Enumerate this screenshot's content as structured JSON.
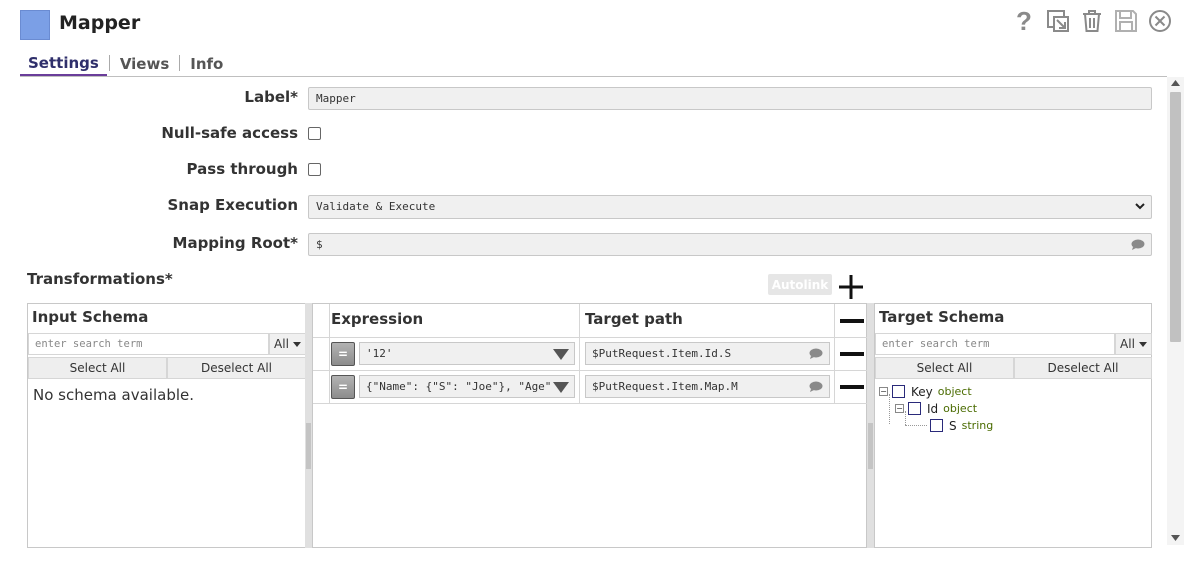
{
  "header": {
    "title": "Mapper",
    "logo_color": "#7b9fe6",
    "icons": [
      "help-icon",
      "export-icon",
      "trash-icon",
      "save-icon",
      "close-icon"
    ]
  },
  "tabs": [
    {
      "label": "Settings",
      "active": true
    },
    {
      "label": "Views",
      "active": false
    },
    {
      "label": "Info",
      "active": false
    }
  ],
  "form": {
    "label": {
      "label": "Label*",
      "value": "Mapper"
    },
    "null_safe": {
      "label": "Null-safe access",
      "checked": false
    },
    "pass_through": {
      "label": "Pass through",
      "checked": false
    },
    "snap_execution": {
      "label": "Snap Execution",
      "value": "Validate & Execute"
    },
    "mapping_root": {
      "label": "Mapping Root*",
      "value": "$"
    }
  },
  "transformations": {
    "title": "Transformations*",
    "autolink_label": "Autolink",
    "input_schema": {
      "title": "Input Schema",
      "search_placeholder": "enter search term",
      "filter": "All",
      "select_all": "Select All",
      "deselect_all": "Deselect All",
      "empty_message": "No schema available."
    },
    "columns": {
      "expression": "Expression",
      "target_path": "Target path"
    },
    "rows": [
      {
        "expression": "'12'",
        "target": "$PutRequest.Item.Id.S"
      },
      {
        "expression": "{\"Name\": {\"S\": \"Joe\"}, \"Age\"",
        "target": "$PutRequest.Item.Map.M"
      }
    ],
    "eq_label": "=",
    "target_schema": {
      "title": "Target Schema",
      "search_placeholder": "enter search term",
      "filter": "All",
      "select_all": "Select All",
      "deselect_all": "Deselect All",
      "tree": [
        {
          "name": "Key",
          "type": "object",
          "toggle": "−"
        },
        {
          "name": "Id",
          "type": "object",
          "toggle": "−"
        },
        {
          "name": "S",
          "type": "string"
        }
      ]
    }
  }
}
